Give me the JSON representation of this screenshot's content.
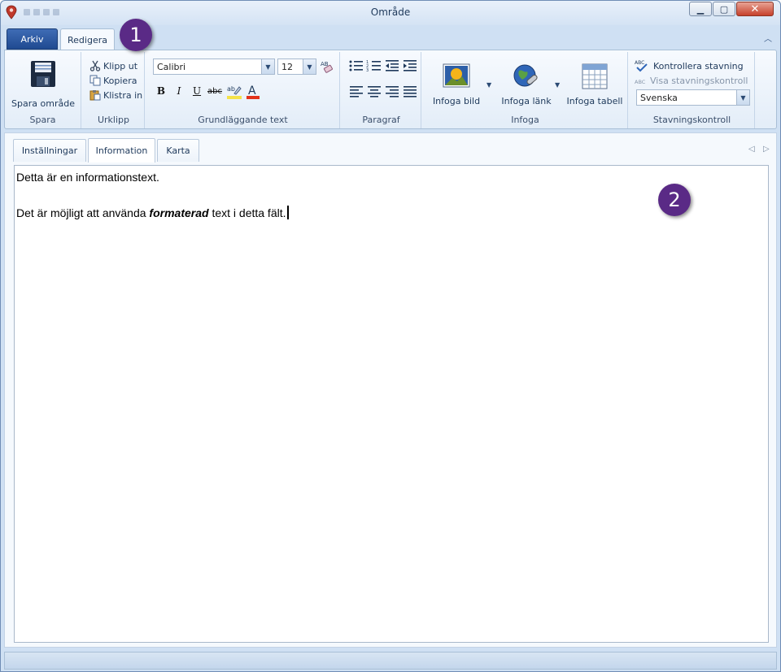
{
  "window": {
    "title": "Område",
    "colors": {
      "accent": "#1f4a91",
      "callout": "#5a2a86",
      "close": "#c6412c"
    }
  },
  "ribbon": {
    "tabs": {
      "file": "Arkiv",
      "edit": "Redigera"
    },
    "groups": {
      "save": {
        "label": "Spara",
        "save_button": "Spara område"
      },
      "clipboard": {
        "label": "Urklipp",
        "cut": "Klipp ut",
        "copy": "Kopiera",
        "paste": "Klistra in"
      },
      "basic_text": {
        "label": "Grundläggande text",
        "font": "Calibri",
        "size": "12"
      },
      "paragraph": {
        "label": "Paragraf"
      },
      "insert": {
        "label": "Infoga",
        "image": "Infoga bild",
        "link": "Infoga länk",
        "table": "Infoga tabell"
      },
      "spelling": {
        "label": "Stavningskontroll",
        "check": "Kontrollera stavning",
        "show": "Visa stavningskontroll",
        "language": "Svenska"
      }
    }
  },
  "content_tabs": [
    "Inställningar",
    "Information",
    "Karta"
  ],
  "editor": {
    "line1": "Detta är en informationstext.",
    "line2_before": "Det är möjligt att använda ",
    "line2_formatted": "formaterad",
    "line2_after": " text i detta fält."
  },
  "callouts": [
    "1",
    "2"
  ]
}
